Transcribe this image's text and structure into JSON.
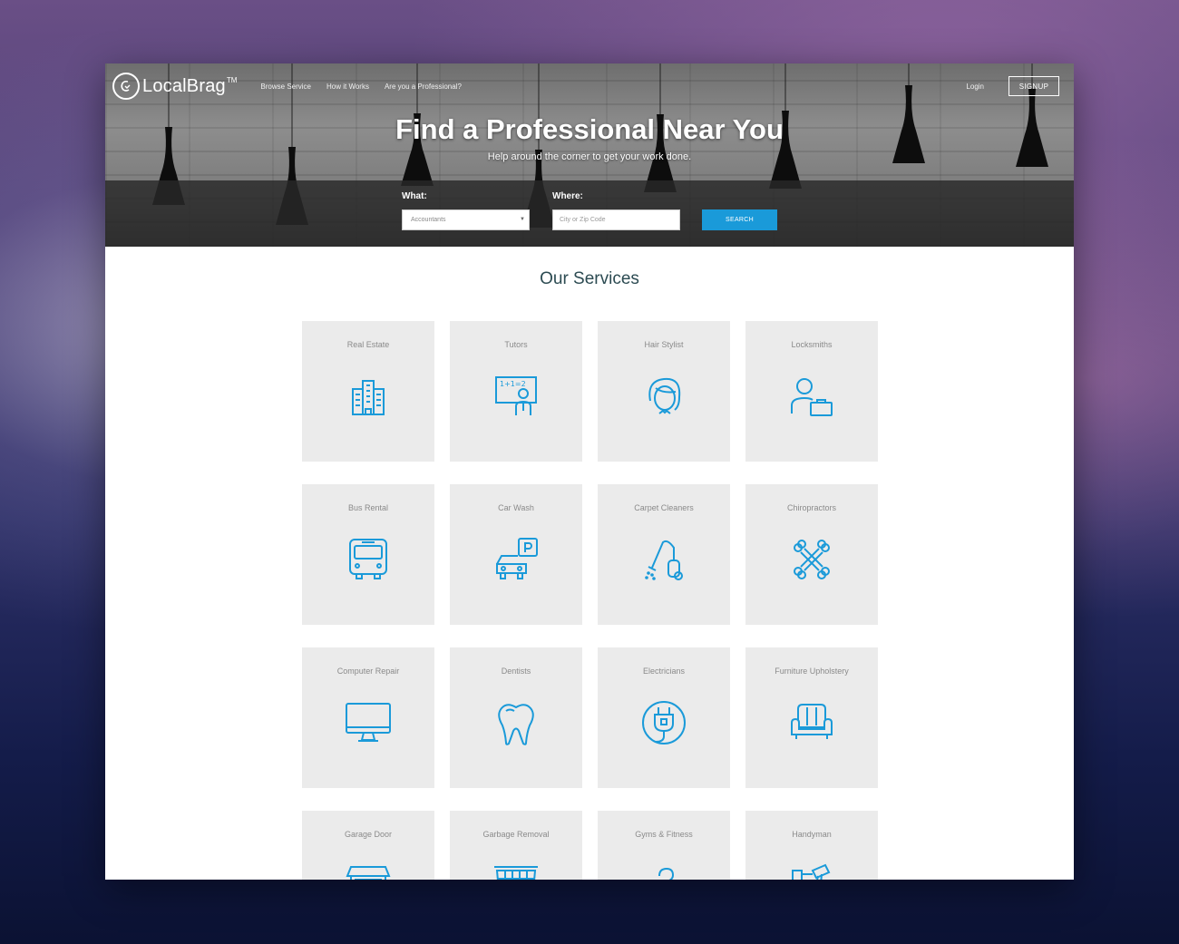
{
  "brand": {
    "name": "LocalBrag",
    "trademark": "TM"
  },
  "nav": {
    "links": [
      "Browse Service",
      "How it Works",
      "Are you a Professional?"
    ],
    "login": "Login",
    "signup": "SIGNUP"
  },
  "hero": {
    "title": "Find a Professional Near You",
    "subtitle": "Help around the corner to get your work done."
  },
  "search": {
    "what_label": "What:",
    "what_value": "Accountants",
    "where_label": "Where:",
    "where_placeholder": "City or Zip Code",
    "button": "SEARCH"
  },
  "services": {
    "title": "Our Services",
    "items": [
      {
        "label": "Real Estate",
        "icon": "building-icon"
      },
      {
        "label": "Tutors",
        "icon": "blackboard-teacher-icon"
      },
      {
        "label": "Hair Stylist",
        "icon": "woman-head-icon"
      },
      {
        "label": "Locksmiths",
        "icon": "person-briefcase-icon"
      },
      {
        "label": "Bus Rental",
        "icon": "bus-icon"
      },
      {
        "label": "Car Wash",
        "icon": "car-parking-icon"
      },
      {
        "label": "Carpet Cleaners",
        "icon": "vacuum-cleaner-icon"
      },
      {
        "label": "Chiropractors",
        "icon": "crossed-bones-icon"
      },
      {
        "label": "Computer Repair",
        "icon": "monitor-icon"
      },
      {
        "label": "Dentists",
        "icon": "tooth-icon"
      },
      {
        "label": "Electricians",
        "icon": "plug-icon"
      },
      {
        "label": "Furniture Upholstery",
        "icon": "armchair-icon"
      },
      {
        "label": "Garage Door",
        "icon": "garage-icon"
      },
      {
        "label": "Garbage Removal",
        "icon": "dumpster-icon"
      },
      {
        "label": "Gyms & Fitness",
        "icon": "fitness-icon"
      },
      {
        "label": "Handyman",
        "icon": "tools-icon"
      }
    ]
  },
  "colors": {
    "accent": "#1a9ad9",
    "card_bg": "#ebebeb",
    "title": "#2c4b52"
  }
}
